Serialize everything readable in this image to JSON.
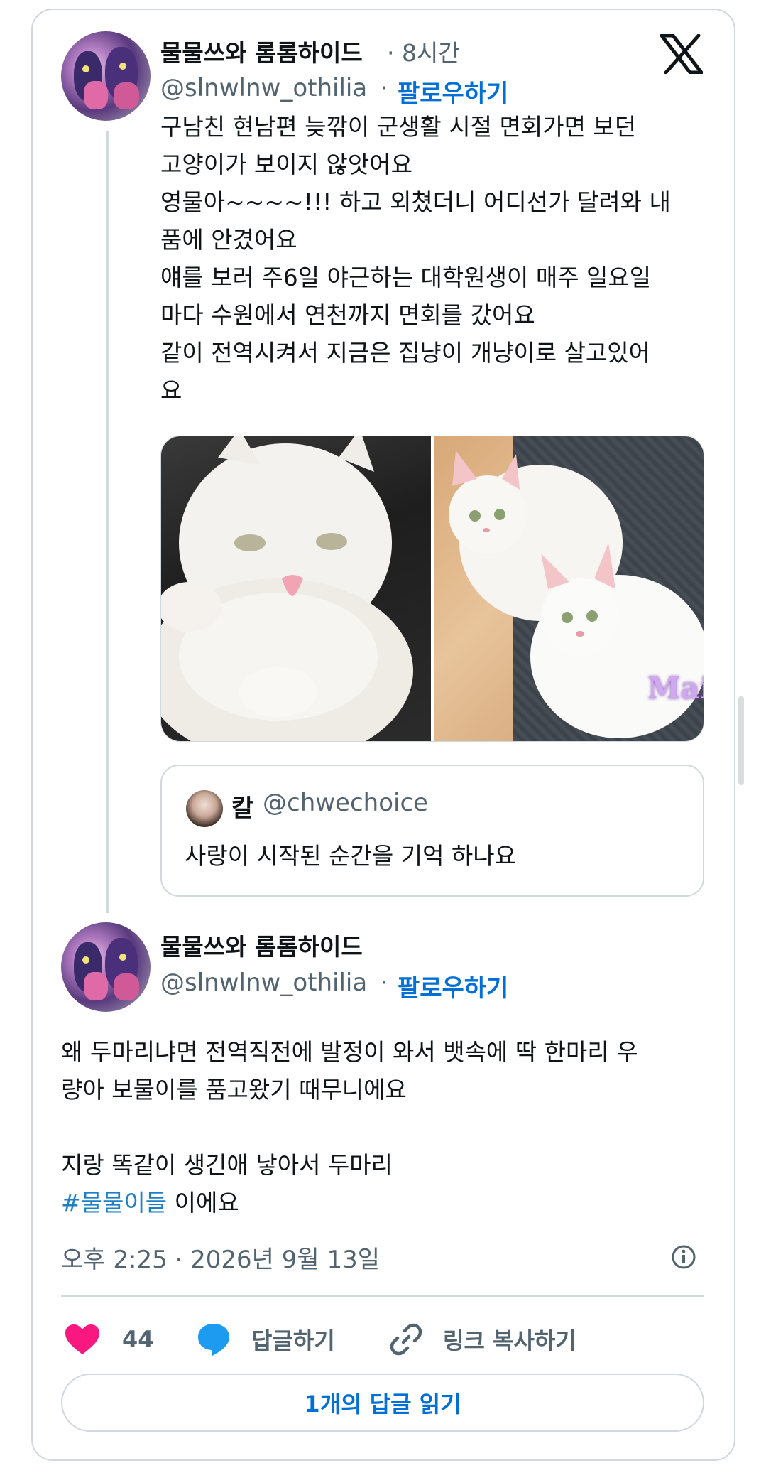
{
  "tweet1": {
    "display_name": "물물쓰와 롬롬하이드",
    "time": "· 8시간",
    "handle": "@slnwlnw_othilia",
    "separator": "·",
    "follow_label": "팔로우하기",
    "lines": [
      "구남친 현남편 늦깎이 군생활 시절 면회가면 보던",
      "고양이가 보이지 않앗어요",
      "영물아~~~~!!! 하고 외쳤더니 어디선가 달려와 내",
      "품에 안겼어요",
      "얘를 보러 주6일 야근하는 대학원생이 매주 일요일",
      "마다 수원에서 연천까지 면회를 갔어요",
      "같이 전역시켜서 지금은 집냥이 개냥이로 살고있어",
      "요"
    ],
    "media_watermark": "Mail",
    "quote": {
      "name": "칼",
      "handle": "@chwechoice",
      "text": "사랑이 시작된 순간을 기억 하나요"
    }
  },
  "tweet2": {
    "display_name": "물물쓰와 롬롬하이드",
    "handle": "@slnwlnw_othilia",
    "separator": "·",
    "follow_label": "팔로우하기",
    "line1": "왜 두마리냐면 전역직전에 발정이 와서 뱃속에 딱 한마리 우",
    "line2": "량아 보물이를 품고왔기 때무니에요",
    "line3": "지랑 똑같이 생긴애 낳아서 두마리",
    "hashtag": "#물물이들",
    "line4_tail": " 이에요",
    "timestamp": "오후 2:25 · 2026년 9월 13일"
  },
  "actions": {
    "like_count": "44",
    "reply_label": "답글하기",
    "copy_link_label": "링크 복사하기",
    "read_replies_label": "1개의 답글 읽기"
  },
  "colors": {
    "like": "#f91880",
    "reply": "#1d9bf0",
    "link": "#006fd6",
    "border": "#cfd9de",
    "secondary_text": "#536471"
  },
  "icons": {
    "brand": "x-logo-icon",
    "like": "heart-icon",
    "reply": "speech-bubble-icon",
    "copy_link": "link-icon",
    "info": "info-icon"
  }
}
